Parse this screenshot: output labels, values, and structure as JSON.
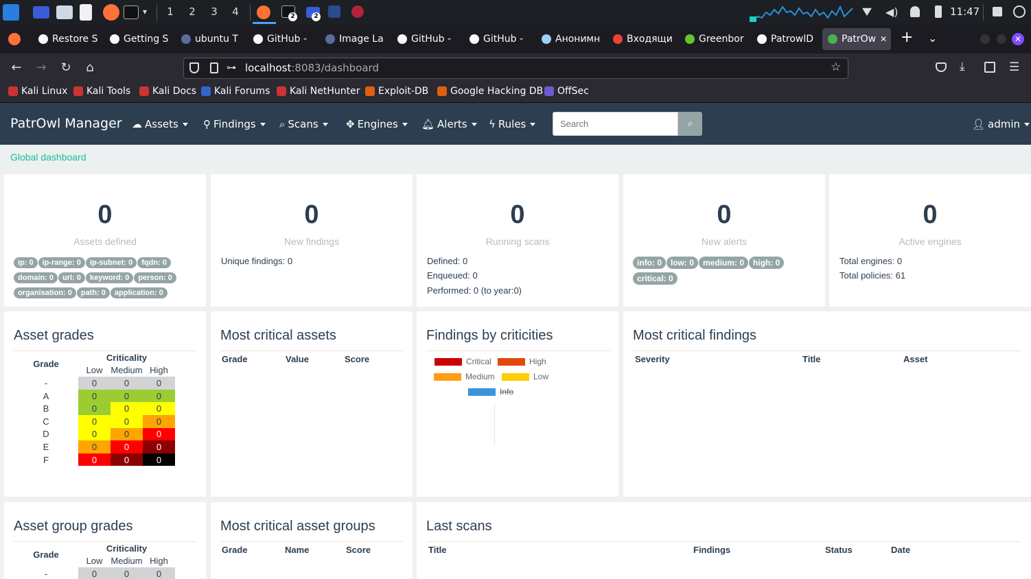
{
  "taskbar": {
    "workspaces": [
      "1",
      "2",
      "3",
      "4"
    ],
    "badge_terminal": "2",
    "badge_files": "2",
    "clock": "11:47"
  },
  "tabs": [
    {
      "label": "Restore S",
      "icon": "info-icon"
    },
    {
      "label": "Getting S",
      "icon": "info-icon"
    },
    {
      "label": "ubuntu T",
      "icon": "globe-icon"
    },
    {
      "label": "GitHub - ",
      "icon": "github-icon"
    },
    {
      "label": "Image La",
      "icon": "globe-icon"
    },
    {
      "label": "GitHub - ",
      "icon": "github-icon"
    },
    {
      "label": "GitHub - ",
      "icon": "github-icon"
    },
    {
      "label": "Анонимн",
      "icon": "extension-icon"
    },
    {
      "label": "Входящи",
      "icon": "gmail-icon"
    },
    {
      "label": "Greenbor",
      "icon": "greenbone-icon"
    },
    {
      "label": "PatrowlD",
      "icon": "github-icon"
    },
    {
      "label": "PatrOw",
      "icon": "patrowl-icon",
      "active": true
    }
  ],
  "url": {
    "host": "localhost",
    "rest": ":8083/dashboard"
  },
  "bookmarks": [
    "Kali Linux",
    "Kali Tools",
    "Kali Docs",
    "Kali Forums",
    "Kali NetHunter",
    "Exploit-DB",
    "Google Hacking DB",
    "OffSec"
  ],
  "app": {
    "brand": "PatrOwl Manager",
    "menu": [
      "Assets",
      "Findings",
      "Scans",
      "Engines",
      "Alerts",
      "Rules"
    ],
    "search_placeholder": "Search",
    "user": "admin",
    "breadcrumb": "Global dashboard"
  },
  "stats": {
    "assets": {
      "value": "0",
      "label": "Assets defined",
      "badges": [
        "ip: 0",
        "ip-range: 0",
        "ip-subnet: 0",
        "fqdn: 0",
        "domain: 0",
        "url: 0",
        "keyword: 0",
        "person: 0",
        "organisation: 0",
        "path: 0",
        "application: 0"
      ]
    },
    "findings": {
      "value": "0",
      "label": "New findings",
      "unique": "Unique findings: 0"
    },
    "scans": {
      "value": "0",
      "label": "Running scans",
      "defined": "Defined: 0",
      "enqueued": "Enqueued: 0",
      "performed": "Performed: 0 (to year:0)"
    },
    "alerts": {
      "value": "0",
      "label": "New alerts",
      "badges": [
        "info: 0",
        "low: 0",
        "medium: 0",
        "high: 0",
        "critical: 0"
      ]
    },
    "engines": {
      "value": "0",
      "label": "Active engines",
      "total_engines": "Total engines: 0",
      "total_policies": "Total policies: 61"
    }
  },
  "asset_grades": {
    "title": "Asset grades",
    "grade_header": "Grade",
    "criticality_header": "Criticality",
    "columns": [
      "Low",
      "Medium",
      "High"
    ],
    "rows": [
      {
        "grade": "-",
        "values": [
          "0",
          "0",
          "0"
        ]
      },
      {
        "grade": "A",
        "values": [
          "0",
          "0",
          "0"
        ]
      },
      {
        "grade": "B",
        "values": [
          "0",
          "0",
          "0"
        ]
      },
      {
        "grade": "C",
        "values": [
          "0",
          "0",
          "0"
        ]
      },
      {
        "grade": "D",
        "values": [
          "0",
          "0",
          "0"
        ]
      },
      {
        "grade": "E",
        "values": [
          "0",
          "0",
          "0"
        ]
      },
      {
        "grade": "F",
        "values": [
          "0",
          "0",
          "0"
        ]
      }
    ]
  },
  "most_critical_assets": {
    "title": "Most critical assets",
    "headers": [
      "Grade",
      "Value",
      "Score"
    ]
  },
  "findings_by_criticities": {
    "title": "Findings by criticities",
    "legend": [
      {
        "label": "Critical",
        "color": "#cc0000"
      },
      {
        "label": "High",
        "color": "#e04a0b"
      },
      {
        "label": "Medium",
        "color": "#ff9e12"
      },
      {
        "label": "Low",
        "color": "#ffcc00"
      },
      {
        "label": "Info",
        "color": "#3b94d9",
        "hidden": true
      }
    ]
  },
  "most_critical_findings": {
    "title": "Most critical findings",
    "headers": [
      "Severity",
      "Title",
      "Asset"
    ]
  },
  "asset_group_grades": {
    "title": "Asset group grades",
    "grade_header": "Grade",
    "criticality_header": "Criticality",
    "columns": [
      "Low",
      "Medium",
      "High"
    ],
    "rows": [
      {
        "grade": "-",
        "values": [
          "0",
          "0",
          "0"
        ]
      }
    ]
  },
  "most_critical_asset_groups": {
    "title": "Most critical asset groups",
    "headers": [
      "Grade",
      "Name",
      "Score"
    ]
  },
  "last_scans": {
    "title": "Last scans",
    "headers": [
      "Title",
      "Findings",
      "Status",
      "Date"
    ]
  }
}
